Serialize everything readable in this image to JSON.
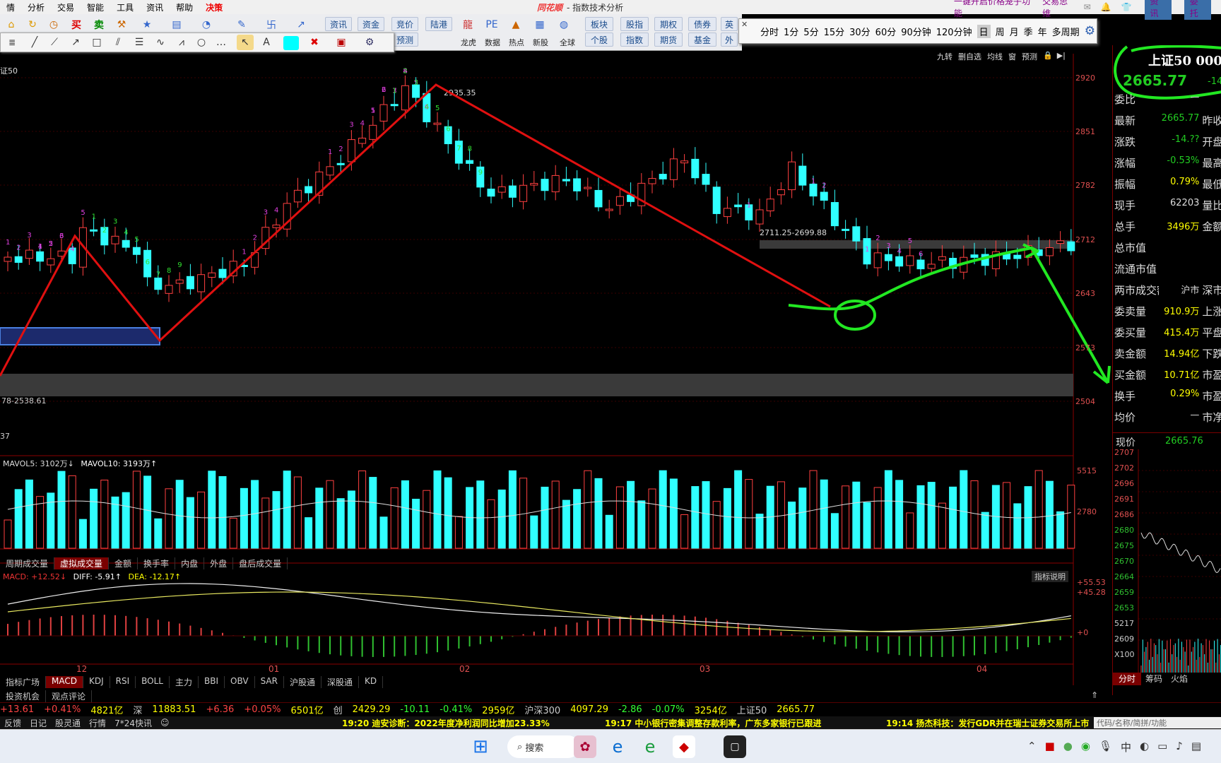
{
  "app": {
    "center_title": "指数技术分析",
    "logo": "同花顺"
  },
  "menu": [
    "情",
    "分析",
    "交易",
    "智能",
    "工具",
    "资讯",
    "帮助",
    "决策"
  ],
  "menu_right": {
    "promo": "一键开启价格笼子功能",
    "think": "交易思维",
    "btn_news": "资讯",
    "btn_user": "委托"
  },
  "toolbar": {
    "row1_buttons": [
      "资讯",
      "资金",
      "竞价",
      "陆港",
      "板块",
      "股指",
      "期权",
      "债券",
      "英"
    ],
    "row2_buttons": [
      "预测",
      "个股",
      "指数",
      "期货",
      "基金",
      "外"
    ],
    "labels": [
      "龙虎",
      "数据",
      "热点",
      "新股",
      "全球"
    ]
  },
  "periods": [
    "分时",
    "1分",
    "5分",
    "15分",
    "30分",
    "60分",
    "90分钟",
    "120分钟",
    "日",
    "周",
    "月",
    "季",
    "年",
    "多周期"
  ],
  "chart": {
    "index_name": "证50",
    "right_tools": [
      "九转",
      "删自选",
      "均线",
      "窗",
      "预测"
    ],
    "peak_label": "2935.35",
    "range_label": "2711.25-2699.88",
    "low_label": "78-2538.61",
    "left_val": "37",
    "price_ticks": [
      "2920",
      "2851",
      "2782",
      "2712",
      "2643",
      "2573",
      "2504"
    ],
    "date_ticks": [
      "12",
      "01",
      "02",
      "03",
      "04"
    ],
    "vol_legend": {
      "mavol5": "MAVOL5: 3102万↓",
      "mavol10": "MAVOL10: 3193万↑"
    },
    "vol_ticks": [
      "5515",
      "2780"
    ],
    "vol_tabs": [
      "周期成交量",
      "虚拟成交量",
      "金额",
      "换手率",
      "内盘",
      "外盘",
      "盘后成交量"
    ],
    "macd_legend": {
      "macd": "MACD: +12.52↓",
      "diff": "DIFF: -5.91↑",
      "dea": "DEA: -12.17↑"
    },
    "macd_ticks": [
      "+55.53",
      "+45.28",
      "+0"
    ],
    "macd_help": "指标说明",
    "indicator_tabs": [
      "指标广场",
      "MACD",
      "KDJ",
      "RSI",
      "BOLL",
      "主力",
      "BBI",
      "OBV",
      "SAR",
      "沪股通",
      "深股通",
      "KD"
    ],
    "bottom_tabs": [
      "投资机会",
      "观点评论"
    ]
  },
  "side": {
    "title": "上证50",
    "title_code": "000",
    "price": "2665.77",
    "change_small": "-14",
    "rows": [
      {
        "label": "委比",
        "value": "—",
        "extra": ""
      },
      {
        "label": "最新",
        "value": "2665.77",
        "extra": "昨收"
      },
      {
        "label": "涨跌",
        "value": "-14.??",
        "extra": "开盘"
      },
      {
        "label": "涨幅",
        "value": "-0.53%",
        "extra": "最高"
      },
      {
        "label": "振幅",
        "value": "0.79%",
        "extra": "最低"
      },
      {
        "label": "现手",
        "value": "62203",
        "extra": "量比"
      },
      {
        "label": "总手",
        "value": "3496万",
        "extra": "金额"
      },
      {
        "label": "总市值",
        "value": "",
        "extra": ""
      },
      {
        "label": "流通市值",
        "value": "",
        "extra": ""
      },
      {
        "label": "两市成交额",
        "value": "沪市",
        "extra": "深市"
      },
      {
        "label": "委卖量",
        "value": "910.9万",
        "extra": "上涨"
      },
      {
        "label": "委买量",
        "value": "415.4万",
        "extra": "平盘"
      },
      {
        "label": "卖金额",
        "value": "14.94亿",
        "extra": "下跌"
      },
      {
        "label": "买金额",
        "value": "10.71亿",
        "extra": "市盈"
      },
      {
        "label": "换手",
        "value": "0.29%",
        "extra": "市盈"
      },
      {
        "label": "均价",
        "value": "—",
        "extra": "市净"
      }
    ],
    "current_label": "现价",
    "current_value": "2665.76",
    "mini_ticks": [
      "2707",
      "2702",
      "2696",
      "2691",
      "2686",
      "2680",
      "2675",
      "2670",
      "2664",
      "2659",
      "2653",
      "5217",
      "2609",
      "X100"
    ],
    "mini_tabs": [
      "分时",
      "筹码",
      "火焰"
    ]
  },
  "ticker": [
    {
      "t": "+13.61",
      "c": "#f44"
    },
    {
      "t": "+0.41%",
      "c": "#f44"
    },
    {
      "t": "4821亿",
      "c": "#ff0"
    },
    {
      "t": "深",
      "c": "#ccc"
    },
    {
      "t": "11883.51",
      "c": "#ff0"
    },
    {
      "t": "+6.36",
      "c": "#f44"
    },
    {
      "t": "+0.05%",
      "c": "#f44"
    },
    {
      "t": "6501亿",
      "c": "#ff0"
    },
    {
      "t": "创",
      "c": "#ccc"
    },
    {
      "t": "2429.29",
      "c": "#ff0"
    },
    {
      "t": "-10.11",
      "c": "#3f3"
    },
    {
      "t": "-0.41%",
      "c": "#3f3"
    },
    {
      "t": "2959亿",
      "c": "#ff0"
    },
    {
      "t": "沪深300",
      "c": "#ccc"
    },
    {
      "t": "4097.29",
      "c": "#ff0"
    },
    {
      "t": "-2.86",
      "c": "#3f3"
    },
    {
      "t": "-0.07%",
      "c": "#3f3"
    },
    {
      "t": "3254亿",
      "c": "#ff0"
    },
    {
      "t": "上证50",
      "c": "#ccc"
    },
    {
      "t": "2665.77",
      "c": "#ff0"
    }
  ],
  "news": {
    "tabs": [
      "反馈",
      "日记",
      "股灵通",
      "行情",
      "7*24快讯"
    ],
    "items": [
      "19:20 迪安诊断：2022年度净利润同比增加23.33%",
      "19:17 中小银行密集调整存款利率，广东多家银行已跟进",
      "19:14 扬杰科技：发行GDR并在瑞士证券交易所上市"
    ],
    "search": "代码/名称/简拼/功能"
  },
  "taskbar": {
    "search": "搜索"
  }
}
